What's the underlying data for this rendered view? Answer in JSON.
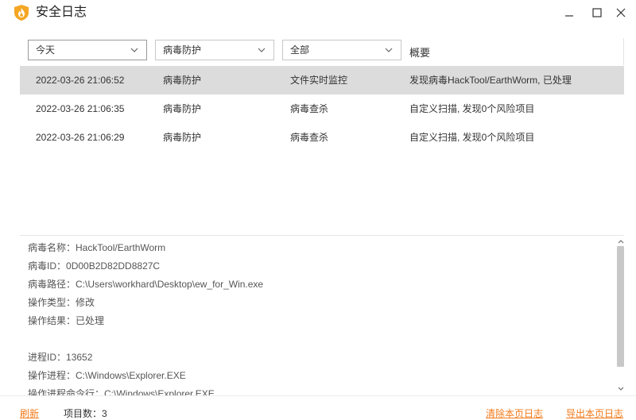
{
  "window": {
    "title": "安全日志",
    "controls": [
      "minimize",
      "maximize",
      "close"
    ],
    "logo_icon": "shield-flame-icon"
  },
  "filters": {
    "date": "今天",
    "module": "病毒防护",
    "type": "全部",
    "summary_header": "概要"
  },
  "logs": [
    {
      "time": "2022-03-26 21:06:52",
      "module": "病毒防护",
      "type": "文件实时监控",
      "summary": "发现病毒HackTool/EarthWorm, 已处理",
      "selected": true
    },
    {
      "time": "2022-03-26 21:06:35",
      "module": "病毒防护",
      "type": "病毒查杀",
      "summary": "自定义扫描, 发现0个风险项目",
      "selected": false
    },
    {
      "time": "2022-03-26 21:06:29",
      "module": "病毒防护",
      "type": "病毒查杀",
      "summary": "自定义扫描, 发现0个风险项目",
      "selected": false
    }
  ],
  "details": [
    {
      "key": "病毒名称：",
      "value": "HackTool/EarthWorm"
    },
    {
      "key": "病毒ID：",
      "value": "0D00B2D82DD8827C"
    },
    {
      "key": "病毒路径：",
      "value": "C:\\Users\\workhard\\Desktop\\ew_for_Win.exe"
    },
    {
      "key": "操作类型：",
      "value": "修改"
    },
    {
      "key": "操作结果：",
      "value": "已处理"
    },
    {
      "key": "",
      "value": ""
    },
    {
      "key": "进程ID：",
      "value": "13652"
    },
    {
      "key": "操作进程：",
      "value": "C:\\Windows\\Explorer.EXE"
    },
    {
      "key": "操作进程命令行：",
      "value": "C:\\Windows\\Explorer.EXE"
    }
  ],
  "footer": {
    "refresh": "刷新",
    "item_count_label": "项目数：",
    "item_count": "3",
    "clear_page": "清除本页日志",
    "export_page": "导出本页日志"
  },
  "colors": {
    "accent": "#f27a1a",
    "selected_row": "#dcdcdc",
    "logo_orange": "#f5a623"
  }
}
